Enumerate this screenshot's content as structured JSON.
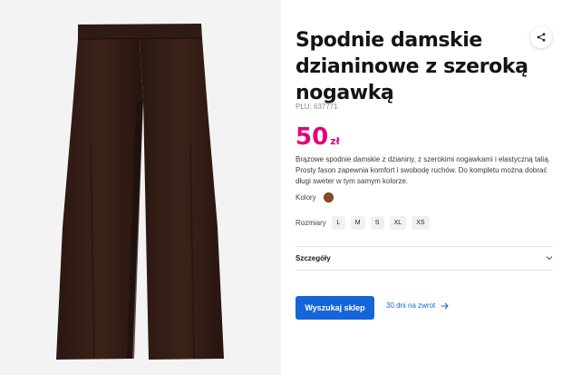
{
  "product": {
    "title": "Spodnie damskie dzianinowe z szeroką nogawką",
    "plu": "PLU: 637771",
    "price_value": "50",
    "price_currency": "zł",
    "description": "Brązowe spodnie damskie z dzianiny, z szerokimi nogawkami i elastyczną talią. Prosty fason zapewnia komfort i swobodę ruchów. Do kompletu można dobrać długi sweter w tym samym kolorze.",
    "image_icon": "brown-wide-leg-knit-trousers"
  },
  "options": {
    "colors_label": "Kolory",
    "selected_color": "#8b4a22",
    "sizes_label": "Rozmiary",
    "sizes": [
      "L",
      "M",
      "S",
      "XL",
      "XS"
    ]
  },
  "details": {
    "label": "Szczegóły"
  },
  "actions": {
    "search_store_label": "Wyszukaj sklep",
    "return_label": "30 dni na zwrot",
    "share_icon": "share-icon",
    "accent": "#1565d8",
    "price_color": "#e4007c"
  }
}
